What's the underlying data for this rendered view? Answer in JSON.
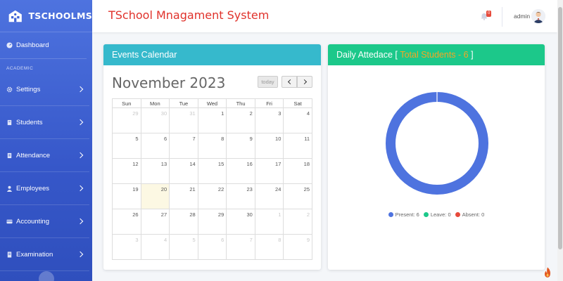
{
  "brand": {
    "name": "TSCHOOLMS"
  },
  "sidebar": {
    "dashboard_label": "Dashboard",
    "section_label": "ACADEMIC",
    "items": [
      {
        "label": "Settings",
        "icon": "gear-icon"
      },
      {
        "label": "Students",
        "icon": "students-icon"
      },
      {
        "label": "Attendance",
        "icon": "attendance-icon"
      },
      {
        "label": "Employees",
        "icon": "employees-icon"
      },
      {
        "label": "Accounting",
        "icon": "accounting-icon"
      },
      {
        "label": "Examination",
        "icon": "examination-icon"
      }
    ]
  },
  "header": {
    "title": "TSchool Mnagament System",
    "notification_count": "0",
    "user_name": "admin"
  },
  "calendar": {
    "card_title": "Events Calendar",
    "month_title": "November 2023",
    "today_label": "today",
    "weekdays": [
      "Sun",
      "Mon",
      "Tue",
      "Wed",
      "Thu",
      "Fri",
      "Sat"
    ],
    "weeks": [
      [
        "29",
        "30",
        "31",
        "1",
        "2",
        "3",
        "4"
      ],
      [
        "5",
        "6",
        "7",
        "8",
        "9",
        "10",
        "11"
      ],
      [
        "12",
        "13",
        "14",
        "15",
        "16",
        "17",
        "18"
      ],
      [
        "19",
        "20",
        "21",
        "22",
        "23",
        "24",
        "25"
      ],
      [
        "26",
        "27",
        "28",
        "29",
        "30",
        "1",
        "2"
      ],
      [
        "3",
        "4",
        "5",
        "6",
        "7",
        "8",
        "9"
      ]
    ],
    "today_date": "20"
  },
  "attendance": {
    "card_title_prefix": "Daily Attedace [ ",
    "card_title_highlight": "Total Students - 6",
    "card_title_suffix": " ]",
    "legend": [
      {
        "label": "Present: 6",
        "color": "#4e73df"
      },
      {
        "label": "Leave: 0",
        "color": "#1cc88a"
      },
      {
        "label": "Absent: 0",
        "color": "#e74a3b"
      }
    ]
  },
  "chart_data": {
    "type": "pie",
    "categories": [
      "Present",
      "Leave",
      "Absent"
    ],
    "values": [
      6,
      0,
      0
    ],
    "colors": [
      "#4e73df",
      "#1cc88a",
      "#e74a3b"
    ],
    "title": "",
    "legend_position": "bottom"
  }
}
